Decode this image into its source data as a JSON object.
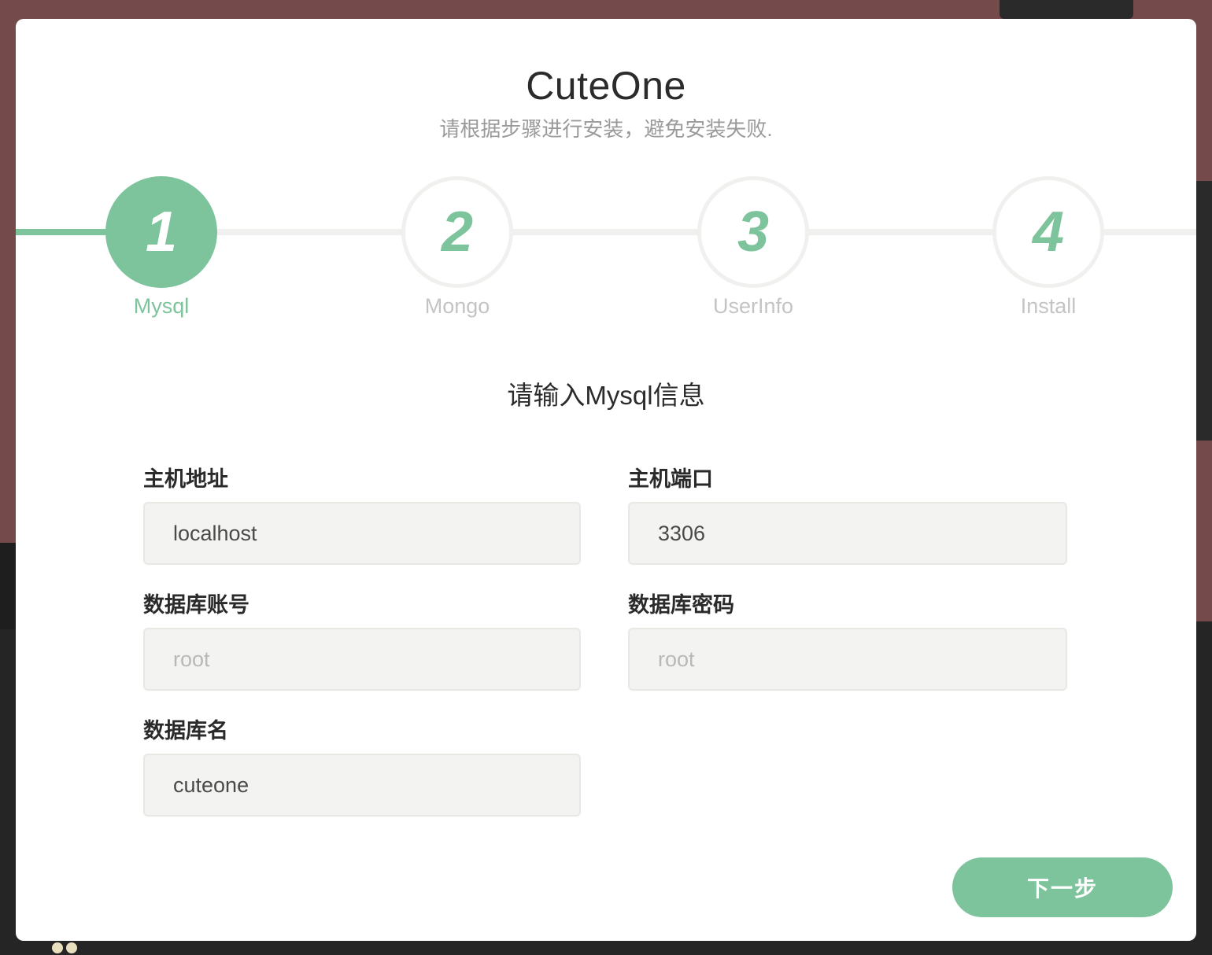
{
  "app": {
    "title": "CuteOne",
    "subtitle": "请根据步骤进行安装，避免安装失败."
  },
  "steps": [
    {
      "number": "1",
      "label": "Mysql",
      "active": true
    },
    {
      "number": "2",
      "label": "Mongo",
      "active": false
    },
    {
      "number": "3",
      "label": "UserInfo",
      "active": false
    },
    {
      "number": "4",
      "label": "Install",
      "active": false
    }
  ],
  "form": {
    "section_title": "请输入Mysql信息",
    "host": {
      "label": "主机地址",
      "value": "localhost",
      "placeholder": ""
    },
    "port": {
      "label": "主机端口",
      "value": "3306",
      "placeholder": ""
    },
    "db_user": {
      "label": "数据库账号",
      "value": "",
      "placeholder": "root"
    },
    "db_password": {
      "label": "数据库密码",
      "value": "",
      "placeholder": "root"
    },
    "db_name": {
      "label": "数据库名",
      "value": "cuteone",
      "placeholder": ""
    }
  },
  "actions": {
    "next_label": "下一步"
  },
  "colors": {
    "accent": "#7dc39b",
    "input_bg": "#f3f3f1",
    "backdrop": "#744a4a"
  }
}
